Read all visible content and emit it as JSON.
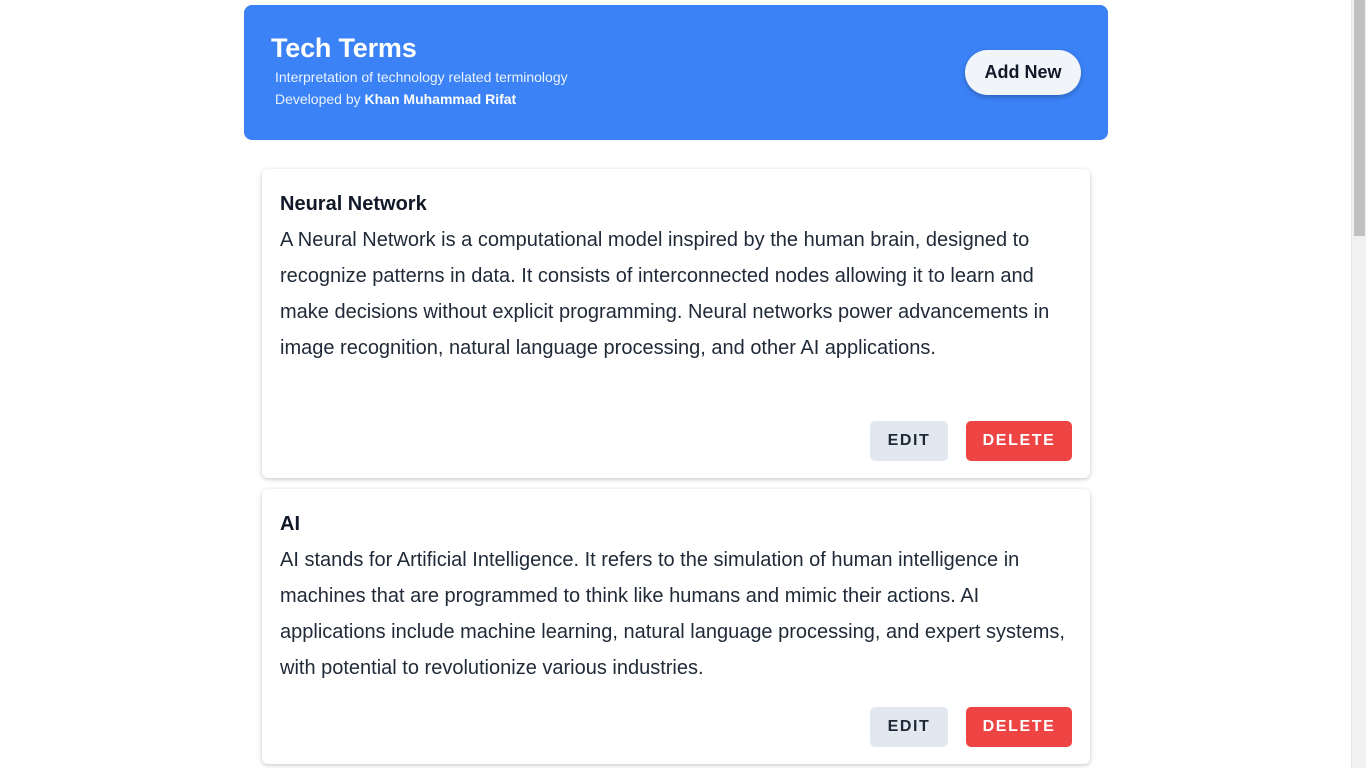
{
  "header": {
    "title": "Tech Terms",
    "subtitle": "Interpretation of technology related terminology",
    "credit_prefix": "Developed by ",
    "credit_name": "Khan Muhammad Rifat",
    "add_label": "Add New"
  },
  "terms": [
    {
      "name": "Neural Network",
      "description": "A Neural Network is a computational model inspired by the human brain, designed to recognize patterns in data. It consists of interconnected nodes allowing it to learn and make decisions without explicit programming. Neural networks power advancements in image recognition, natural language processing, and other AI applications.",
      "edit_label": "EDIT",
      "delete_label": "DELETE"
    },
    {
      "name": "AI",
      "description": "AI stands for Artificial Intelligence. It refers to the simulation of human intelligence in machines that are programmed to think like humans and mimic their actions. AI applications include machine learning, natural language processing, and expert systems, with potential to revolutionize various industries.",
      "edit_label": "EDIT",
      "delete_label": "DELETE"
    }
  ],
  "colors": {
    "header_bg": "#3b82f6",
    "edit_bg": "#e2e8f0",
    "delete_bg": "#ef4444"
  }
}
